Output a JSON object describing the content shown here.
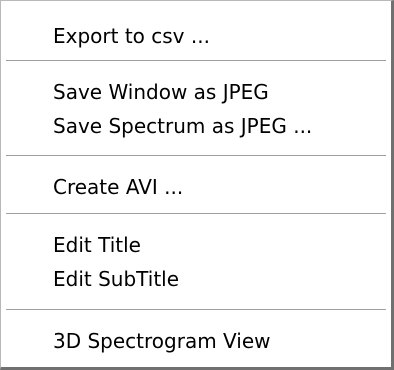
{
  "menu": {
    "export_csv": "Export to csv ...",
    "save_window_jpeg": "Save Window as JPEG",
    "save_spectrum_jpeg": "Save Spectrum as JPEG ...",
    "create_avi": "Create AVI ...",
    "edit_title": "Edit Title",
    "edit_subtitle": "Edit SubTitle",
    "spectrogram_3d": "3D Spectrogram View"
  }
}
